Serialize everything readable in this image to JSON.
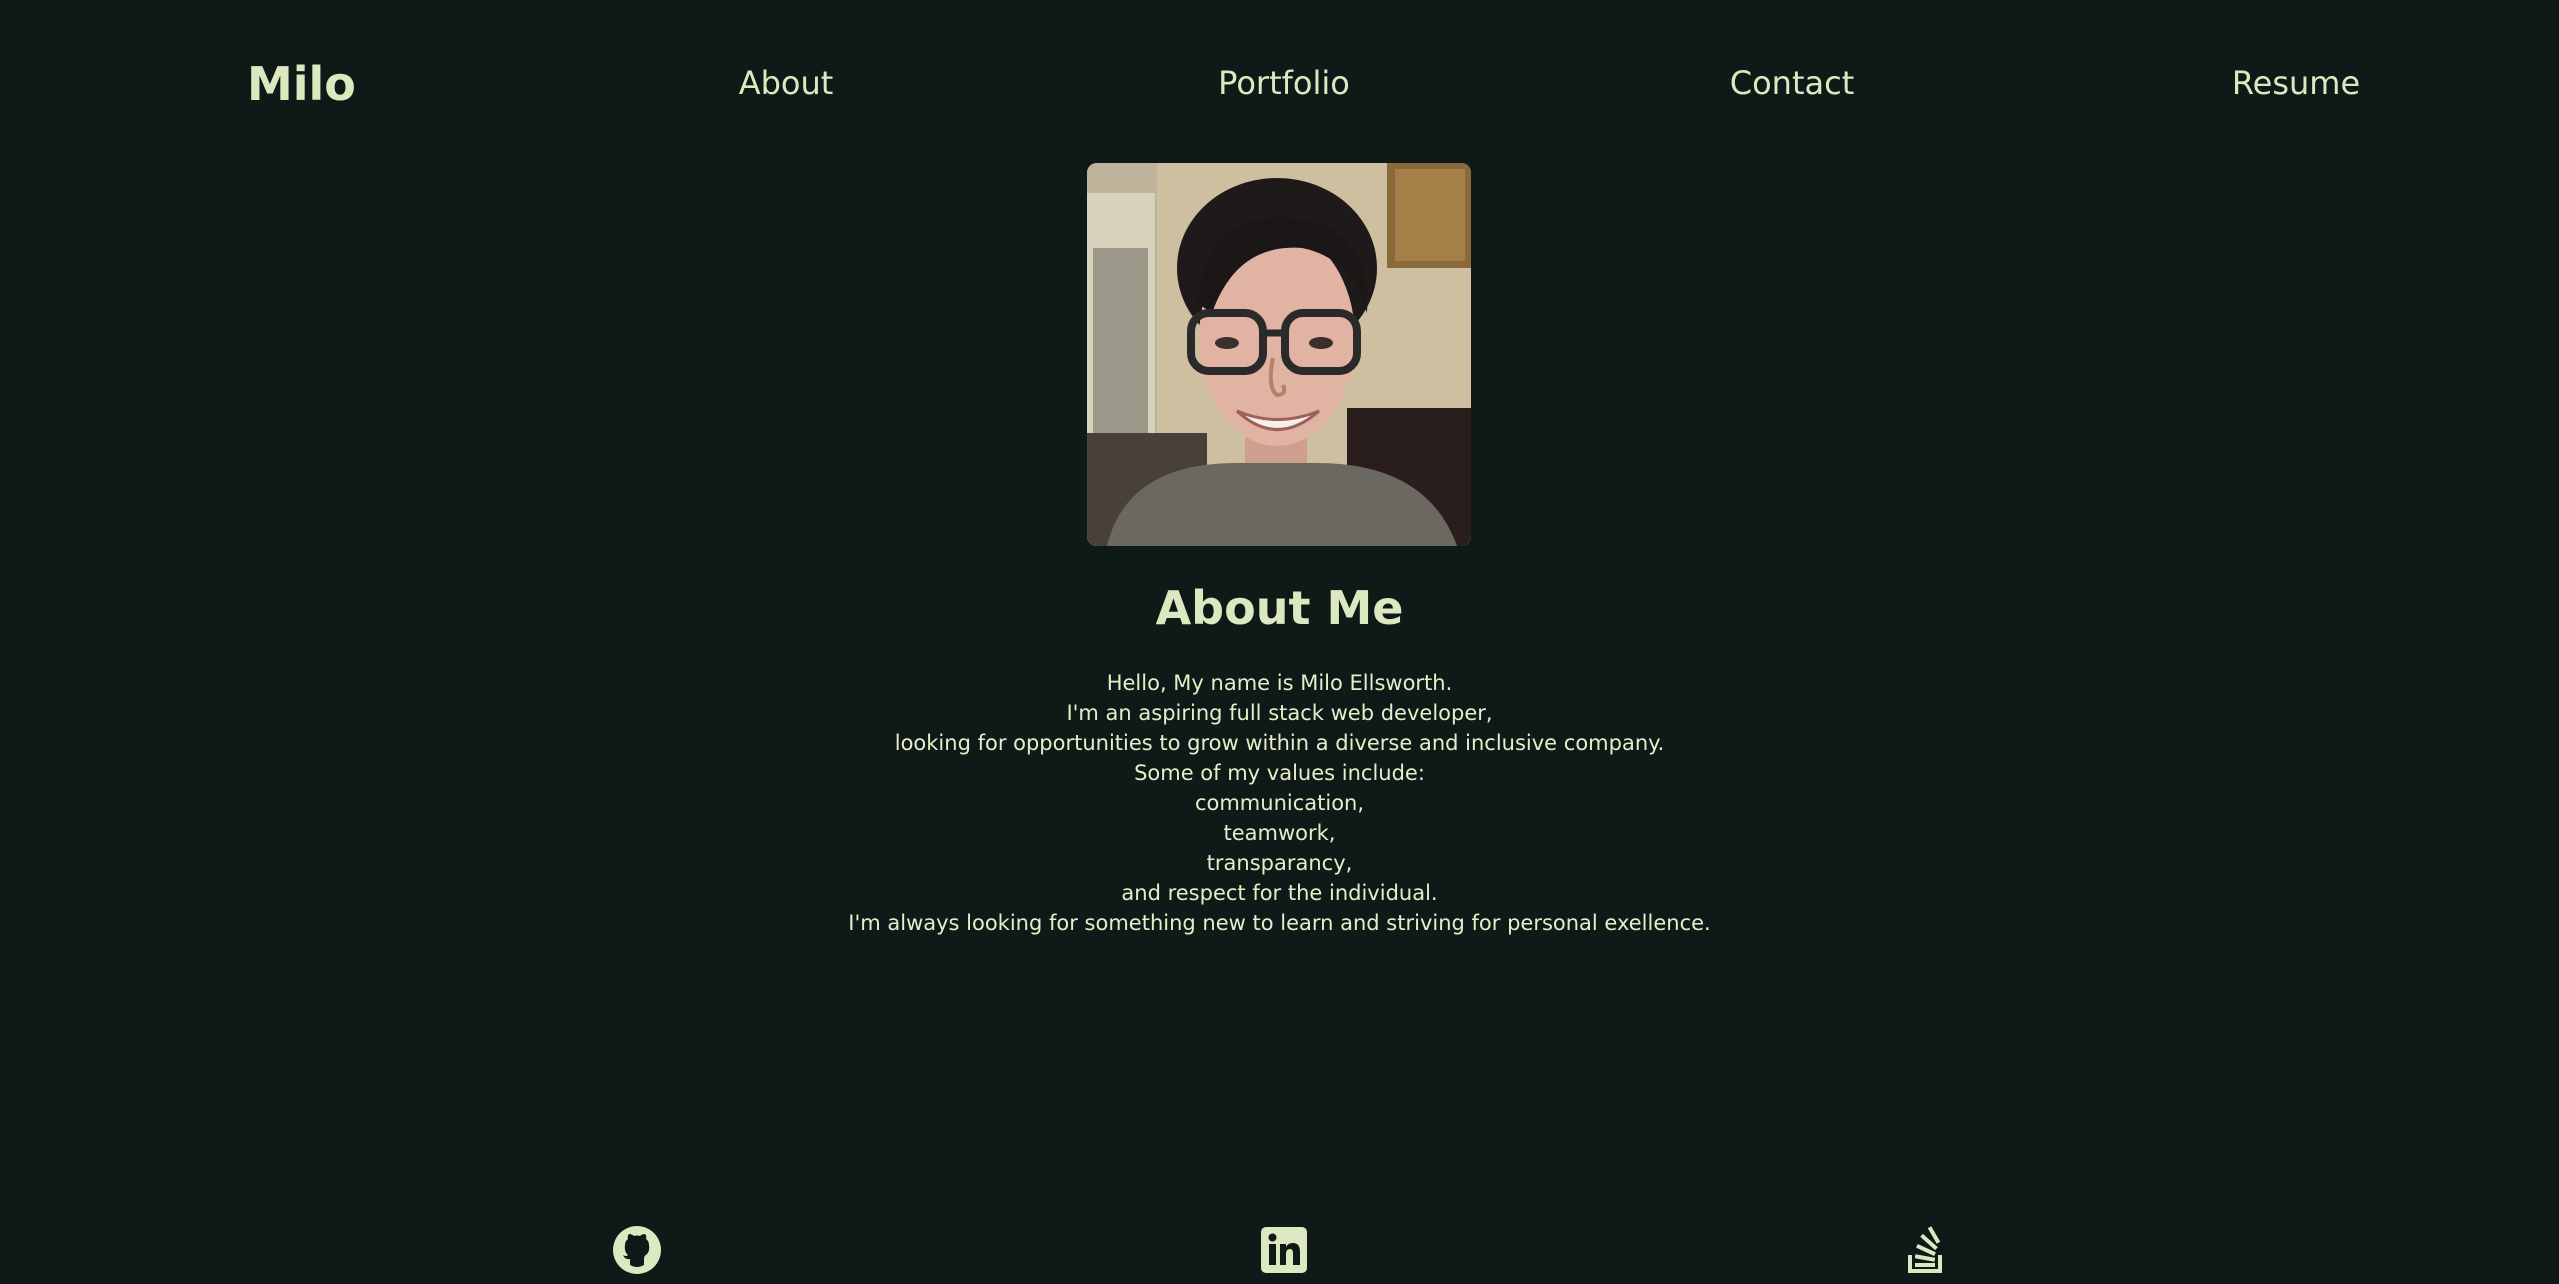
{
  "nav": {
    "brand": "Milo",
    "links": [
      {
        "label": "About"
      },
      {
        "label": "Portfolio"
      },
      {
        "label": "Contact"
      },
      {
        "label": "Resume"
      }
    ]
  },
  "about": {
    "title": "About Me",
    "bio_lines": [
      "Hello, My name is Milo Ellsworth.",
      "I'm an aspiring full stack web developer,",
      "looking for opportunities to grow within a diverse and inclusive company.",
      "Some of my values include:",
      "communication,",
      "teamwork,",
      "transparancy,",
      "and respect for the individual.",
      "I'm always looking for something new to learn and striving for personal exellence."
    ]
  },
  "social": {
    "icons": [
      "github-icon",
      "linkedin-icon",
      "stack-overflow-icon"
    ]
  },
  "colors": {
    "background": "#0f1a18",
    "text": "#dce8bf"
  }
}
